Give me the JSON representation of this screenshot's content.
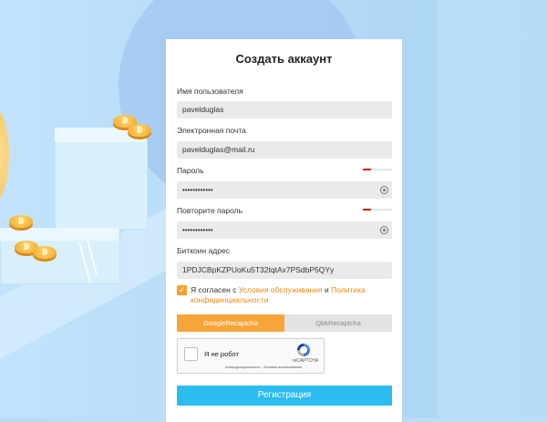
{
  "form": {
    "title": "Создать аккаунт",
    "username": {
      "label": "Имя пользователя",
      "value": "pavelduglas"
    },
    "email": {
      "label": "Электронная почта",
      "value": "pavelduglas@mail.ru"
    },
    "password": {
      "label": "Пароль",
      "value": "••••••••••••",
      "strength_fraction": 0.28
    },
    "confirm_password": {
      "label": "Повторите пароль",
      "value": "••••••••••••",
      "strength_fraction": 0.28
    },
    "bitcoin": {
      "label": "Биткоин адрес",
      "value": "1PDJCBpKZPUoKu5T32tqtAx7PSdbP5QYy"
    },
    "agreement": {
      "checked": true,
      "prefix": "Я согласен с ",
      "terms_link": "Условия обслуживания",
      "and": " и ",
      "privacy_link": "Политика конфиденциальности"
    },
    "captcha_tabs": [
      "GoogleRecaptcha",
      "QbkRecaptcha"
    ],
    "recaptcha": {
      "label": "Я не робот",
      "brand": "reCAPTCHA",
      "links": "Конфиденциальность - Условия использования"
    },
    "submit_label": "Регистрация"
  },
  "coin_symbol": "₿",
  "colors": {
    "accent_orange": "#f6a53a",
    "submit_blue": "#2bbcf0",
    "strength_red": "#e12424"
  }
}
